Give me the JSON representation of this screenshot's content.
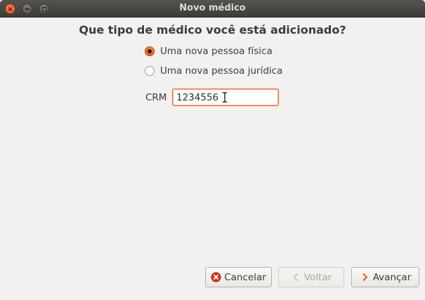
{
  "window": {
    "title": "Novo médico"
  },
  "form": {
    "question": "Que tipo de médico você está adicionado?",
    "options": [
      {
        "label": "Uma nova pessoa física",
        "checked": true
      },
      {
        "label": "Uma nova pessoa jurídica",
        "checked": false
      }
    ],
    "crm_label": "CRM",
    "crm_value": "1234556"
  },
  "buttons": {
    "cancel": "Cancelar",
    "back": "Voltar",
    "next": "Avançar"
  },
  "colors": {
    "accent": "#e95420",
    "cancel_icon": "#d63a2a"
  },
  "icons": {
    "close": "close-icon",
    "minimize": "minimize-icon",
    "maximize": "maximize-icon",
    "cancel": "cancel-icon",
    "back": "chevron-left-icon",
    "next": "chevron-right-icon"
  }
}
